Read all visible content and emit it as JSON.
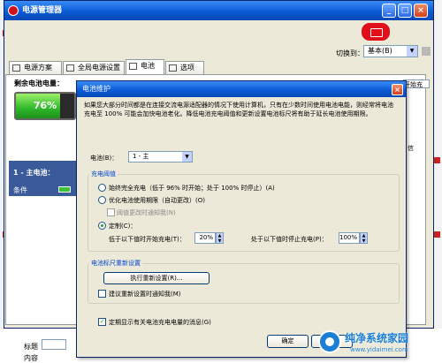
{
  "app": {
    "title": "电源管理器",
    "switch_label": "切换到：",
    "switch_value": "基本(B)"
  },
  "tabs": [
    {
      "label": "电源方案"
    },
    {
      "label": "全局电源设置"
    },
    {
      "label": "电池"
    },
    {
      "label": "选项"
    }
  ],
  "battery": {
    "remaining_label": "剩余电池电量：",
    "percent": "76%",
    "percent_value": 0.76,
    "name": "1 - 主电池：",
    "condition_label": "条件",
    "side_text": "开始充",
    "side_text2": "信"
  },
  "dialog": {
    "title": "电池维护",
    "intro": "如果您大部分时间都是在连接交流电源适配器的情况下使用计算机，只有在少数时间使用电池电能，则经常将电池充电至 100% 可能会加快电池老化。降低电池充电阈值和更新设置电池标尺将有助于延长电池使用期限。",
    "battery_label": "电池(B)：",
    "battery_value": "1 - 主",
    "threshold_group": "充电阈值",
    "opt_full": "始终完全充电（低于 96% 时开始；处于 100% 时停止）(A)",
    "opt_optimize": "优化电池使用期限（自动更改）(O)",
    "notify_change": "阈值更改时通知我(N)",
    "opt_custom": "定制(C)：",
    "start_label": "低于以下值时开始充电(T)：",
    "start_value": "20%",
    "stop_label": "处于以下值时停止充电(P)：",
    "stop_value": "100%",
    "reset_group": "电池标尺重新设置",
    "reset_button": "执行重新设置(R)...",
    "reset_notify": "建议重新设置时通知我(M)",
    "show_msg": "定期显示有关电池充电电量的消息(G)",
    "ok": "确定",
    "cancel": "取消"
  },
  "background": {
    "title_label": "标题",
    "content_label": "内容"
  },
  "watermark": {
    "name": "纯净系统家园",
    "url": "www.yidaimei.com"
  }
}
